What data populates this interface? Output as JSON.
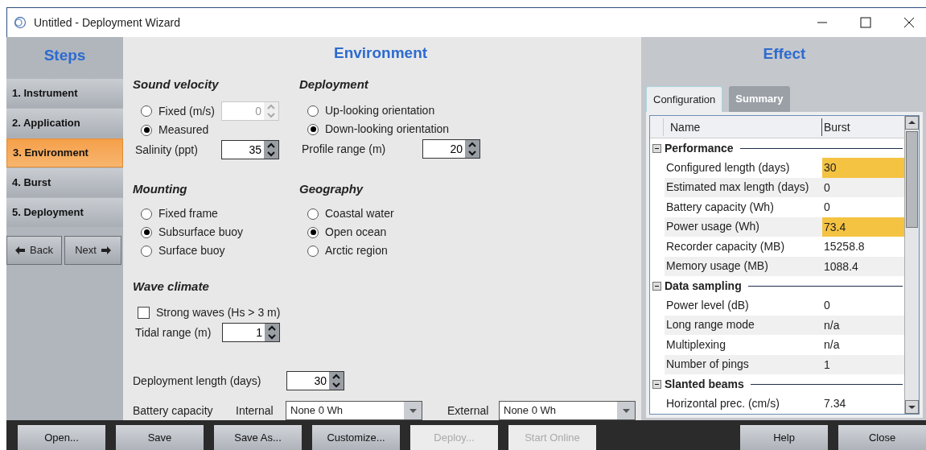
{
  "window": {
    "title": "Untitled - Deployment Wizard"
  },
  "steps": {
    "title": "Steps",
    "items": [
      {
        "label": "1. Instrument",
        "selected": false
      },
      {
        "label": "2. Application",
        "selected": false
      },
      {
        "label": "3. Environment",
        "selected": true
      },
      {
        "label": "4. Burst",
        "selected": false
      },
      {
        "label": "5. Deployment",
        "selected": false
      }
    ],
    "back": "Back",
    "next": "Next"
  },
  "environment": {
    "title": "Environment",
    "sound_velocity": {
      "title": "Sound velocity",
      "options": [
        {
          "label": "Fixed (m/s)",
          "selected": false,
          "field": {
            "value": "0",
            "disabled": true
          }
        },
        {
          "label": "Measured",
          "selected": true
        }
      ],
      "salinity": {
        "label": "Salinity (ppt)",
        "value": "35",
        "disabled": false
      }
    },
    "deployment": {
      "title": "Deployment",
      "options": [
        {
          "label": "Up-looking orientation",
          "selected": false
        },
        {
          "label": "Down-looking orientation",
          "selected": true
        }
      ],
      "profile_range": {
        "label": "Profile range (m)",
        "value": "20",
        "disabled": false
      }
    },
    "mounting": {
      "title": "Mounting",
      "options": [
        {
          "label": "Fixed frame",
          "selected": false
        },
        {
          "label": "Subsurface buoy",
          "selected": true
        },
        {
          "label": "Surface buoy",
          "selected": false
        }
      ]
    },
    "geography": {
      "title": "Geography",
      "options": [
        {
          "label": "Coastal water",
          "selected": false
        },
        {
          "label": "Open ocean",
          "selected": true
        },
        {
          "label": "Arctic region",
          "selected": false
        }
      ]
    },
    "wave_climate": {
      "title": "Wave climate",
      "strong_waves": {
        "label": "Strong waves (Hs > 3 m)",
        "checked": false
      },
      "tidal_range": {
        "label": "Tidal range (m)",
        "value": "1",
        "disabled": false
      }
    },
    "deployment_length": {
      "label": "Deployment length (days)",
      "value": "30",
      "disabled": false
    },
    "battery": {
      "label": "Battery capacity",
      "internal": {
        "label": "Internal",
        "value": "None 0 Wh"
      },
      "external": {
        "label": "External",
        "value": "None 0 Wh"
      }
    }
  },
  "effect": {
    "title": "Effect",
    "tabs": [
      {
        "label": "Configuration",
        "selected": true
      },
      {
        "label": "Summary",
        "selected": false
      }
    ],
    "columns": [
      "Name",
      "Burst"
    ],
    "groups": [
      {
        "title": "Performance",
        "expanded": true,
        "rows": [
          {
            "name": "Configured length (days)",
            "value": "30",
            "highlighted": true
          },
          {
            "name": "Estimated max length (days)",
            "value": "0",
            "highlighted": false
          },
          {
            "name": "Battery capacity (Wh)",
            "value": "0",
            "highlighted": false
          },
          {
            "name": "Power usage (Wh)",
            "value": "73.4",
            "highlighted": true
          },
          {
            "name": "Recorder capacity (MB)",
            "value": "15258.8",
            "highlighted": false
          },
          {
            "name": "Memory usage (MB)",
            "value": "1088.4",
            "highlighted": false
          }
        ]
      },
      {
        "title": "Data sampling",
        "expanded": true,
        "rows": [
          {
            "name": "Power level (dB)",
            "value": "0",
            "highlighted": false
          },
          {
            "name": "Long range mode",
            "value": "n/a",
            "highlighted": false
          },
          {
            "name": "Multiplexing",
            "value": "n/a",
            "highlighted": false
          },
          {
            "name": "Number of pings",
            "value": "1",
            "highlighted": false
          }
        ]
      },
      {
        "title": "Slanted beams",
        "expanded": true,
        "rows": [
          {
            "name": "Horizontal prec. (cm/s)",
            "value": "7.34",
            "highlighted": false
          }
        ]
      }
    ]
  },
  "buttons": {
    "left": [
      {
        "label": "Open...",
        "disabled": false
      },
      {
        "label": "Save",
        "disabled": false
      },
      {
        "label": "Save As...",
        "disabled": false
      },
      {
        "label": "Customize...",
        "disabled": false
      },
      {
        "label": "Deploy...",
        "disabled": true
      },
      {
        "label": "Start Online",
        "disabled": true
      }
    ],
    "right": [
      {
        "label": "Help",
        "disabled": false
      },
      {
        "label": "Close",
        "disabled": false
      }
    ]
  }
}
